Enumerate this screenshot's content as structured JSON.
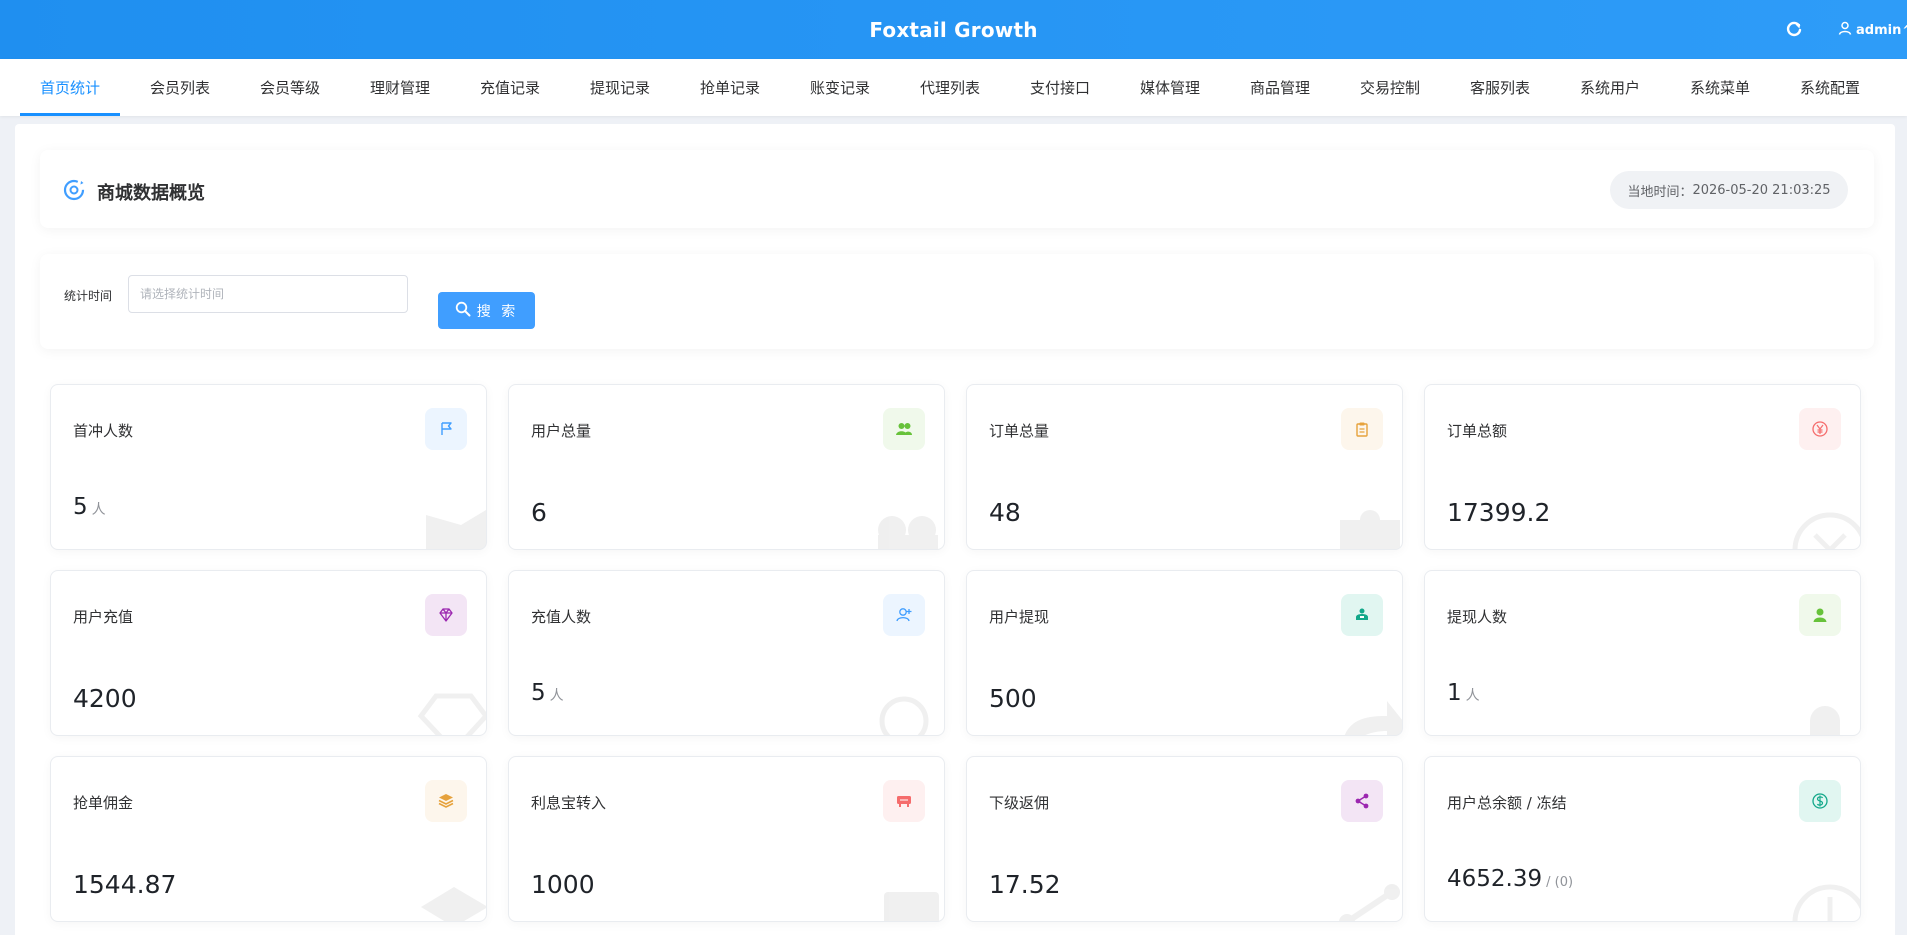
{
  "app": {
    "title": "Foxtail Growth",
    "user": "admin"
  },
  "nav": [
    {
      "label": "首页统计"
    },
    {
      "label": "会员列表"
    },
    {
      "label": "会员等级"
    },
    {
      "label": "理财管理"
    },
    {
      "label": "充值记录"
    },
    {
      "label": "提现记录"
    },
    {
      "label": "抢单记录"
    },
    {
      "label": "账变记录"
    },
    {
      "label": "代理列表"
    },
    {
      "label": "支付接口"
    },
    {
      "label": "媒体管理"
    },
    {
      "label": "商品管理"
    },
    {
      "label": "交易控制"
    },
    {
      "label": "客服列表"
    },
    {
      "label": "系统用户"
    },
    {
      "label": "系统菜单"
    },
    {
      "label": "系统配置"
    }
  ],
  "header": {
    "title": "商城数据概览",
    "time_label": "当地时间：",
    "time_value": "2026-05-20 21:03:25"
  },
  "search": {
    "label": "统计时间",
    "placeholder": "请选择统计时间",
    "button": "搜 索"
  },
  "stats": [
    {
      "label": "首冲人数",
      "value": "5",
      "unit": "人",
      "icon": "flag-icon",
      "color": "#409eff",
      "bg": "#ecf5ff"
    },
    {
      "label": "用户总量",
      "value": "6",
      "icon": "users-icon",
      "color": "#67c23a",
      "bg": "#f0f9eb"
    },
    {
      "label": "订单总量",
      "value": "48",
      "icon": "clipboard-icon",
      "color": "#e6a23c",
      "bg": "#fdf6ec"
    },
    {
      "label": "订单总额",
      "value": "17399.2",
      "icon": "yen-icon",
      "color": "#f56c6c",
      "bg": "#fef0f0"
    },
    {
      "label": "用户充值",
      "value": "4200",
      "icon": "diamond-icon",
      "color": "#9c27b0",
      "bg": "#f3e5f5"
    },
    {
      "label": "充值人数",
      "value": "5",
      "unit": "人",
      "icon": "user-plus-icon",
      "color": "#409eff",
      "bg": "#ecf5ff"
    },
    {
      "label": "用户提现",
      "value": "500",
      "icon": "cash-icon",
      "color": "#13a88a",
      "bg": "#e1f6f1"
    },
    {
      "label": "提现人数",
      "value": "1",
      "unit": "人",
      "icon": "user-icon",
      "color": "#67c23a",
      "bg": "#f0f9eb"
    },
    {
      "label": "抢单佣金",
      "value": "1544.87",
      "icon": "layers-icon",
      "color": "#e6a23c",
      "bg": "#fdf6ec"
    },
    {
      "label": "利息宝转入",
      "value": "1000",
      "icon": "ticket-icon",
      "color": "#f56c6c",
      "bg": "#fef0f0"
    },
    {
      "label": "下级返佣",
      "value": "17.52",
      "icon": "share-icon",
      "color": "#9c27b0",
      "bg": "#f3e5f5"
    },
    {
      "label": "用户总余额 / 冻结",
      "value": "4652.39",
      "suffix": "/ (0)",
      "icon": "dollar-icon",
      "color": "#13a88a",
      "bg": "#e1f6f1"
    }
  ]
}
